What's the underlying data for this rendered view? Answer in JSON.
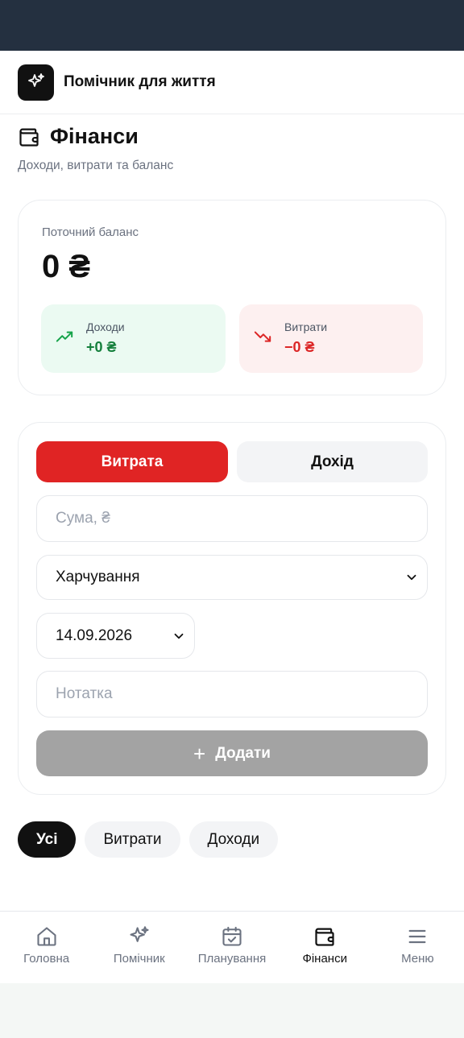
{
  "header": {
    "app_title": "Помічник для життя",
    "logo_icon": "sparkles-icon"
  },
  "page": {
    "title": "Фінанси",
    "subtitle": "Доходи, витрати та баланс",
    "title_icon": "wallet-icon"
  },
  "balance": {
    "label": "Поточний баланс",
    "value": "0 ₴",
    "income": {
      "label": "Доходи",
      "value": "+0 ₴",
      "icon": "trending-up-icon",
      "color": "#15803d"
    },
    "expense": {
      "label": "Витрати",
      "value": "−0 ₴",
      "icon": "trending-down-icon",
      "color": "#dc2626"
    }
  },
  "form": {
    "toggle_expense": "Витрата",
    "toggle_income": "Дохід",
    "amount_placeholder": "Сума, ₴",
    "category_value": "Харчування",
    "date_value": "14.09.2026",
    "note_placeholder": "Нотатка",
    "add_label": "Додати",
    "accent_color": "#e02424"
  },
  "filters": [
    {
      "label": "Усі",
      "active": true
    },
    {
      "label": "Витрати",
      "active": false
    },
    {
      "label": "Доходи",
      "active": false
    }
  ],
  "nav": [
    {
      "label": "Головна",
      "icon": "home-icon"
    },
    {
      "label": "Помічник",
      "icon": "sparkles-icon"
    },
    {
      "label": "Планування",
      "icon": "calendar-check-icon"
    },
    {
      "label": "Фінанси",
      "icon": "wallet-icon",
      "active": true
    },
    {
      "label": "Меню",
      "icon": "menu-icon"
    }
  ]
}
